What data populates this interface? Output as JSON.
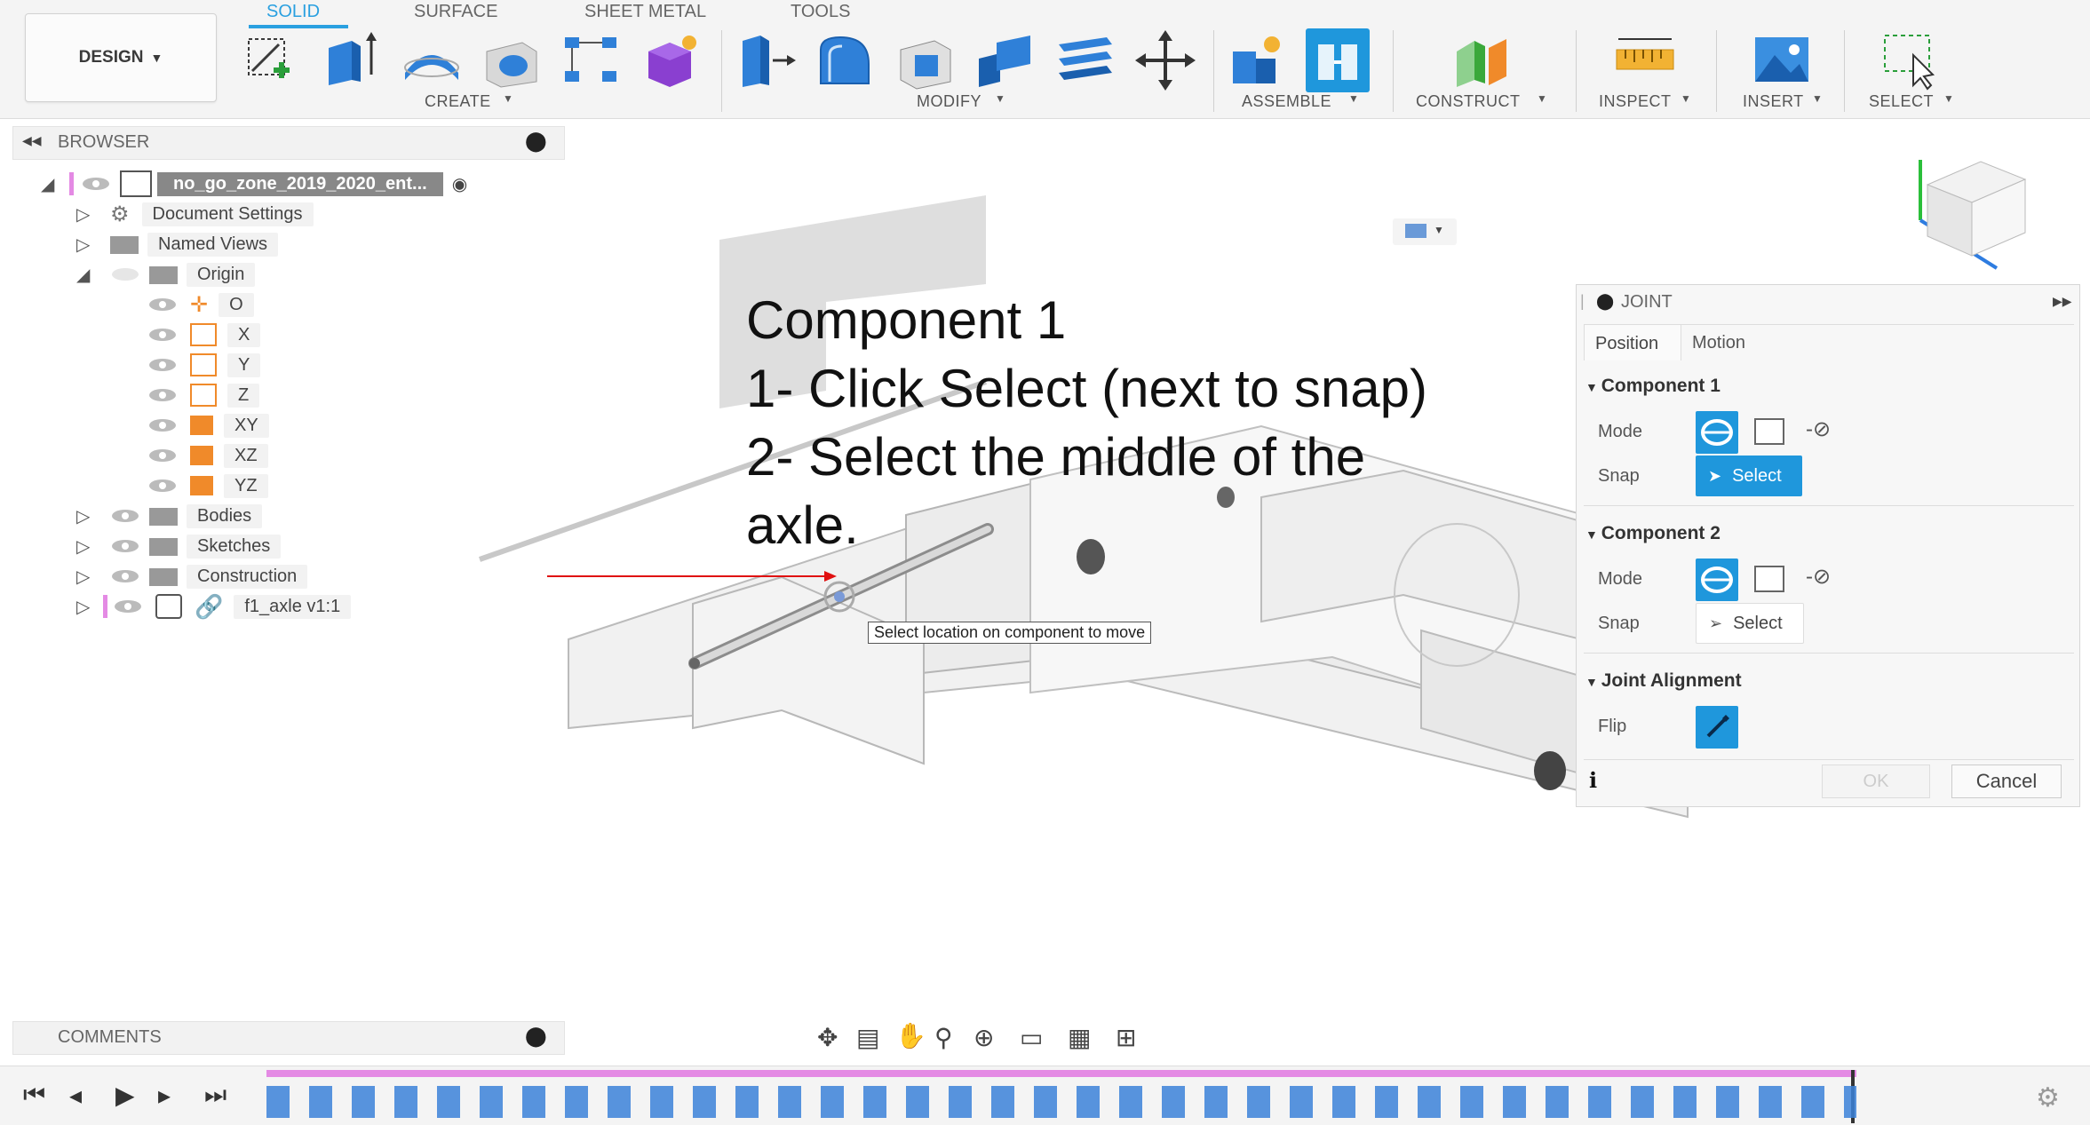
{
  "toolbar": {
    "design_label": "DESIGN",
    "tabs": [
      "SOLID",
      "SURFACE",
      "SHEET METAL",
      "TOOLS"
    ],
    "groups": [
      "CREATE",
      "MODIFY",
      "ASSEMBLE",
      "CONSTRUCT",
      "INSPECT",
      "INSERT",
      "SELECT"
    ]
  },
  "browser": {
    "title": "BROWSER",
    "root": "no_go_zone_2019_2020_ent...",
    "items": [
      {
        "label": "Document Settings"
      },
      {
        "label": "Named Views"
      },
      {
        "label": "Origin"
      },
      {
        "label": "O"
      },
      {
        "label": "X"
      },
      {
        "label": "Y"
      },
      {
        "label": "Z"
      },
      {
        "label": "XY"
      },
      {
        "label": "XZ"
      },
      {
        "label": "YZ"
      },
      {
        "label": "Bodies"
      },
      {
        "label": "Sketches"
      },
      {
        "label": "Construction"
      },
      {
        "label": "f1_axle v1:1"
      }
    ]
  },
  "instruction": {
    "lines": [
      "Component 1",
      "1- Click Select (next to snap)",
      "2- Select the middle of the",
      "axle."
    ]
  },
  "tooltip": "Select location on component to move",
  "joint": {
    "title": "JOINT",
    "tabs": [
      "Position",
      "Motion"
    ],
    "component1": {
      "title": "Component 1",
      "mode_label": "Mode",
      "snap_label": "Snap",
      "select_label": "Select"
    },
    "component2": {
      "title": "Component 2",
      "mode_label": "Mode",
      "snap_label": "Snap",
      "select_label": "Select"
    },
    "alignment": {
      "title": "Joint Alignment",
      "flip_label": "Flip"
    },
    "ok_label": "OK",
    "cancel_label": "Cancel"
  },
  "comments": {
    "title": "COMMENTS"
  },
  "colors": {
    "accent": "#1f97dc",
    "tab_active": "#2aa0e0",
    "timeline_bar": "#e48ae4",
    "pointer_arrow": "#e01010"
  }
}
